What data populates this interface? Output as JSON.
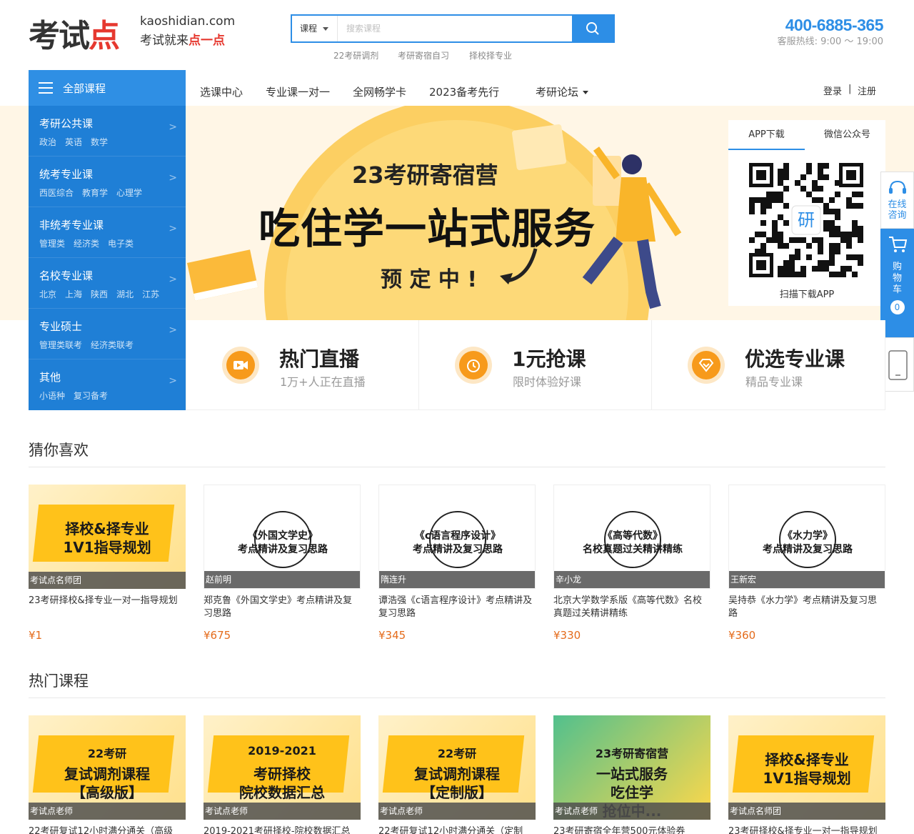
{
  "header": {
    "logo_text": "考试",
    "logo_dot": "点",
    "site": "kaoshidian.com",
    "slogan_a": "考试就来",
    "slogan_b": "点一点",
    "search": {
      "type_label": "课程",
      "placeholder": "搜索课程"
    },
    "hotwords": [
      "22考研调剂",
      "考研寄宿自习",
      "择校择专业"
    ],
    "hotline": "400-6885-365",
    "hours": "客服热线: 9:00 ～ 19:00"
  },
  "nav": {
    "all_courses": "全部课程",
    "items": [
      "选课中心",
      "专业课一对一",
      "全网畅学卡",
      "2023备考先行",
      "考研论坛"
    ],
    "login": "登录",
    "sep": "|",
    "register": "注册"
  },
  "categories": [
    {
      "title": "考研公共课",
      "subs": [
        "政治",
        "英语",
        "数学"
      ]
    },
    {
      "title": "统考专业课",
      "subs": [
        "西医综合",
        "教育学",
        "心理学"
      ]
    },
    {
      "title": "非统考专业课",
      "subs": [
        "管理类",
        "经济类",
        "电子类"
      ]
    },
    {
      "title": "名校专业课",
      "subs": [
        "北京",
        "上海",
        "陕西",
        "湖北",
        "江苏"
      ]
    },
    {
      "title": "专业硕士",
      "subs": [
        "管理类联考",
        "经济类联考"
      ]
    },
    {
      "title": "其他",
      "subs": [
        "小语种",
        "复习备考"
      ]
    }
  ],
  "banner": {
    "line1": "23考研寄宿营",
    "line2": "吃住学一站式服务",
    "line3": "预 定 中 !"
  },
  "qr": {
    "tab1": "APP下载",
    "tab2": "微信公众号",
    "center": "研",
    "caption": "扫描下载APP"
  },
  "float": {
    "consult": [
      "在线",
      "咨询"
    ],
    "cart": [
      "购",
      "物",
      "车"
    ],
    "cart_count": "0"
  },
  "features": [
    {
      "title": "热门直播",
      "sub": "1万+人正在直播",
      "icon": "video-icon"
    },
    {
      "title": "1元抢课",
      "sub": "限时体验好课",
      "icon": "alarm-clock-icon"
    },
    {
      "title": "优选专业课",
      "sub": "精品专业课",
      "icon": "diamond-icon"
    }
  ],
  "guess": {
    "title": "猜你喜欢",
    "cards": [
      {
        "thumb_lines": [
          "择校&择专业",
          "1V1指导规划"
        ],
        "teacher": "考试点名师团",
        "title": "23考研择校&择专业一对一指导规划",
        "price": "¥1",
        "style": "yellow"
      },
      {
        "thumb_lines": [
          "《外国文学史》",
          "考点精讲及复习思路"
        ],
        "teacher": "赵前明",
        "title": "郑克鲁《外国文学史》考点精讲及复习思路",
        "price": "¥675",
        "style": "white"
      },
      {
        "thumb_lines": [
          "《c语言程序设计》",
          "考点精讲及复习思路"
        ],
        "teacher": "隋连升",
        "title": "谭浩强《c语言程序设计》考点精讲及复习思路",
        "price": "¥345",
        "style": "white"
      },
      {
        "thumb_lines": [
          "《高等代数》",
          "名校真题过关精讲精练"
        ],
        "teacher": "辛小龙",
        "title": "北京大学数学系版《高等代数》名校真题过关精讲精练",
        "price": "¥330",
        "style": "white"
      },
      {
        "thumb_lines": [
          "《水力学》",
          "考点精讲及复习思路"
        ],
        "teacher": "王新宏",
        "title": "吴持恭《水力学》考点精讲及复习思路",
        "price": "¥360",
        "style": "white"
      }
    ]
  },
  "hot": {
    "title": "热门课程",
    "cards": [
      {
        "thumb_lines": [
          "22考研",
          "复试调剂课程",
          "【高级版】"
        ],
        "teacher": "考试点老师",
        "title": "22考研复试12小时满分通关（高级",
        "style": "yellow"
      },
      {
        "thumb_lines": [
          "2019-2021",
          "考研择校",
          "院校数据汇总"
        ],
        "teacher": "考试点老师",
        "title": "2019-2021考研择校-院校数据汇总",
        "style": "yellow"
      },
      {
        "thumb_lines": [
          "22考研",
          "复试调剂课程",
          "【定制版】"
        ],
        "teacher": "考试点老师",
        "title": "22考研复试12小时满分通关（定制",
        "style": "yellow"
      },
      {
        "thumb_lines": [
          "23考研寄宿营",
          "一站式服务",
          "吃住学",
          "抢位中..."
        ],
        "teacher": "考试点老师",
        "title": "23考研寄宿全年营500元体验券",
        "style": "green"
      },
      {
        "thumb_lines": [
          "择校&择专业",
          "1V1指导规划"
        ],
        "teacher": "考试点名师团",
        "title": "23考研择校&择专业一对一指导规划",
        "style": "yellow"
      }
    ]
  },
  "colors": {
    "brand_blue": "#2d8ee6",
    "sidebar_blue": "#1f7fd6",
    "price_orange": "#e46b1b",
    "accent_yellow": "#f9b52a"
  }
}
